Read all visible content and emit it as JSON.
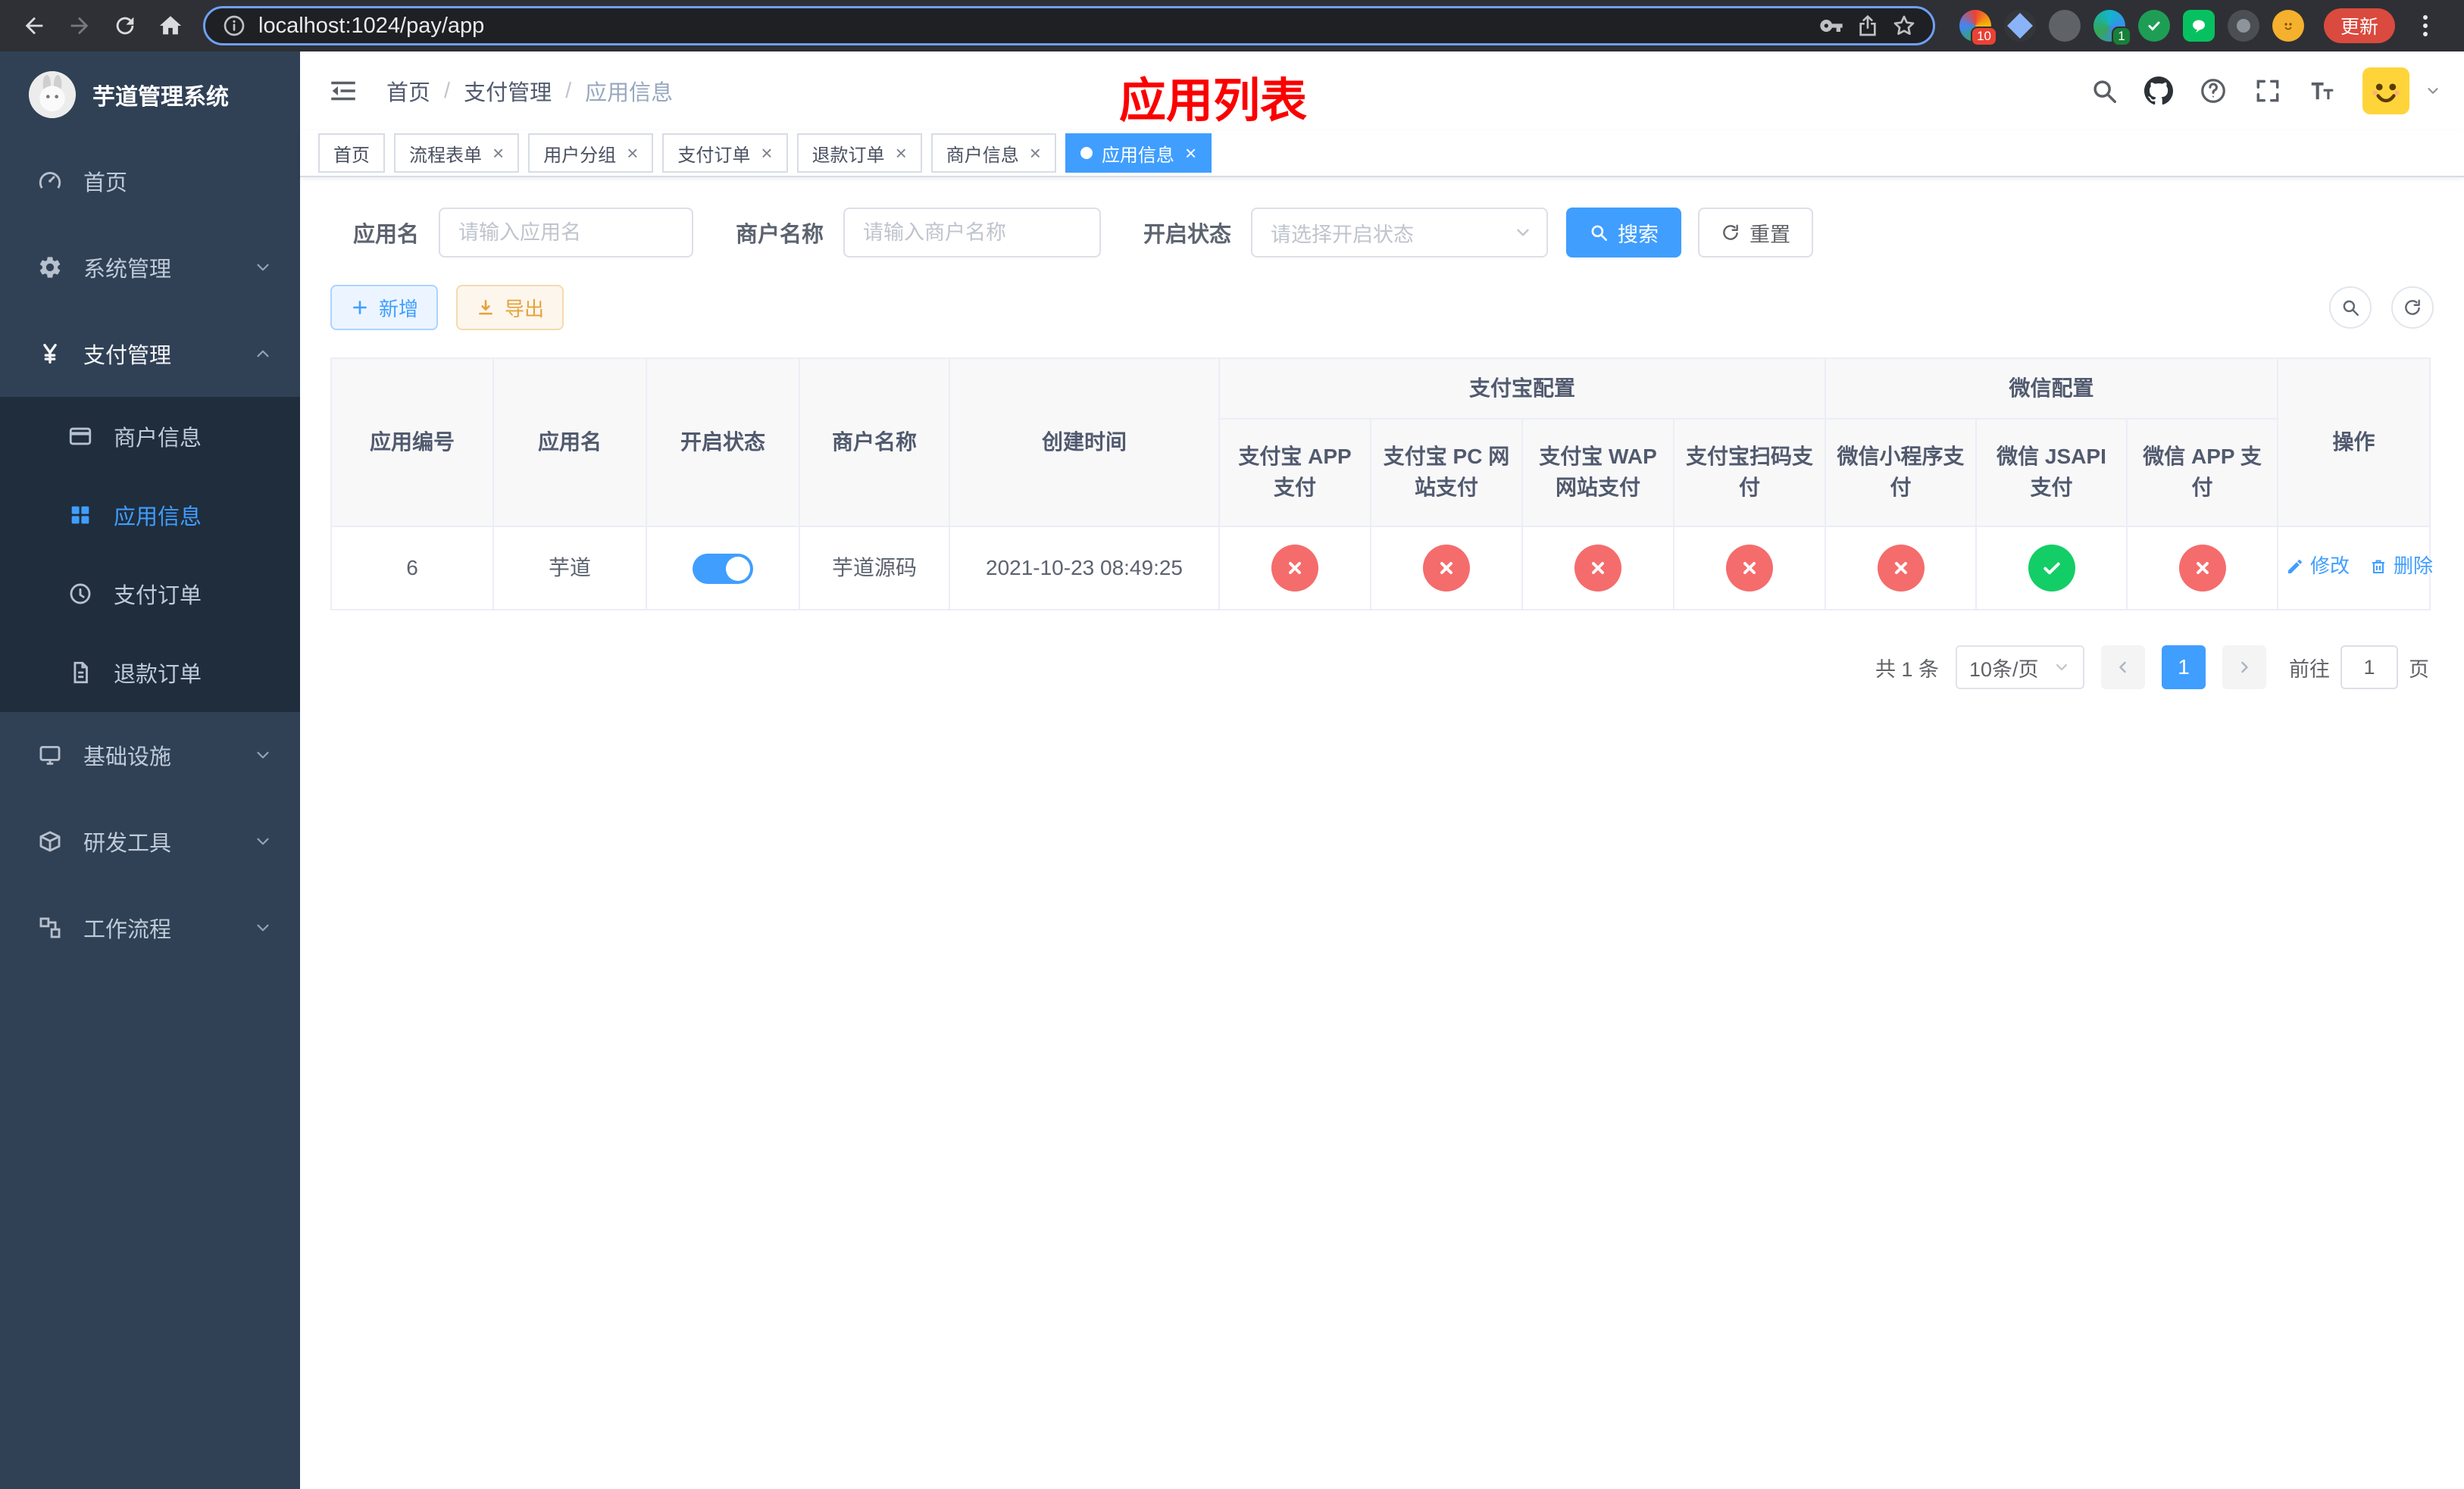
{
  "browser": {
    "url": "localhost:1024/pay/app",
    "update_button": "更新",
    "extension_badge_a": "10",
    "extension_badge_b": "1"
  },
  "sidebar": {
    "title": "芋道管理系统",
    "items": [
      {
        "label": "首页"
      },
      {
        "label": "系统管理"
      },
      {
        "label": "支付管理"
      },
      {
        "label": "商户信息"
      },
      {
        "label": "应用信息"
      },
      {
        "label": "支付订单"
      },
      {
        "label": "退款订单"
      },
      {
        "label": "基础设施"
      },
      {
        "label": "研发工具"
      },
      {
        "label": "工作流程"
      }
    ]
  },
  "header": {
    "breadcrumb": [
      "首页",
      "支付管理",
      "应用信息"
    ],
    "annotation": "应用列表"
  },
  "tabs": [
    {
      "label": "首页",
      "closable": false,
      "active": false
    },
    {
      "label": "流程表单",
      "closable": true,
      "active": false
    },
    {
      "label": "用户分组",
      "closable": true,
      "active": false
    },
    {
      "label": "支付订单",
      "closable": true,
      "active": false
    },
    {
      "label": "退款订单",
      "closable": true,
      "active": false
    },
    {
      "label": "商户信息",
      "closable": true,
      "active": false
    },
    {
      "label": "应用信息",
      "closable": true,
      "active": true
    }
  ],
  "filters": {
    "app_name": {
      "label": "应用名",
      "placeholder": "请输入应用名"
    },
    "merchant_name": {
      "label": "商户名称",
      "placeholder": "请输入商户名称"
    },
    "status": {
      "label": "开启状态",
      "placeholder": "请选择开启状态"
    },
    "search_button": "搜索",
    "reset_button": "重置"
  },
  "toolbar": {
    "add_button": "新增",
    "export_button": "导出"
  },
  "table": {
    "groups": {
      "alipay": "支付宝配置",
      "wechat": "微信配置"
    },
    "columns": [
      "应用编号",
      "应用名",
      "开启状态",
      "商户名称",
      "创建时间",
      "支付宝 APP 支付",
      "支付宝 PC 网站支付",
      "支付宝 WAP 网站支付",
      "支付宝扫码支付",
      "微信小程序支付",
      "微信 JSAPI 支付",
      "微信 APP 支付",
      "操作"
    ],
    "rows": [
      {
        "id": "6",
        "name": "芋道",
        "enabled": true,
        "merchant": "芋道源码",
        "created_at": "2021-10-23 08:49:25",
        "statuses": [
          false,
          false,
          false,
          false,
          false,
          true,
          false
        ],
        "edit_label": "修改",
        "delete_label": "删除"
      }
    ]
  },
  "pagination": {
    "total": "共 1 条",
    "page_size": "10条/页",
    "page": "1",
    "goto_label": "前往",
    "goto_value": "1",
    "goto_unit": "页"
  },
  "colors": {
    "primary": "#409eff",
    "danger": "#f56c6c",
    "success": "#13ce66",
    "sidebar": "#304156"
  }
}
